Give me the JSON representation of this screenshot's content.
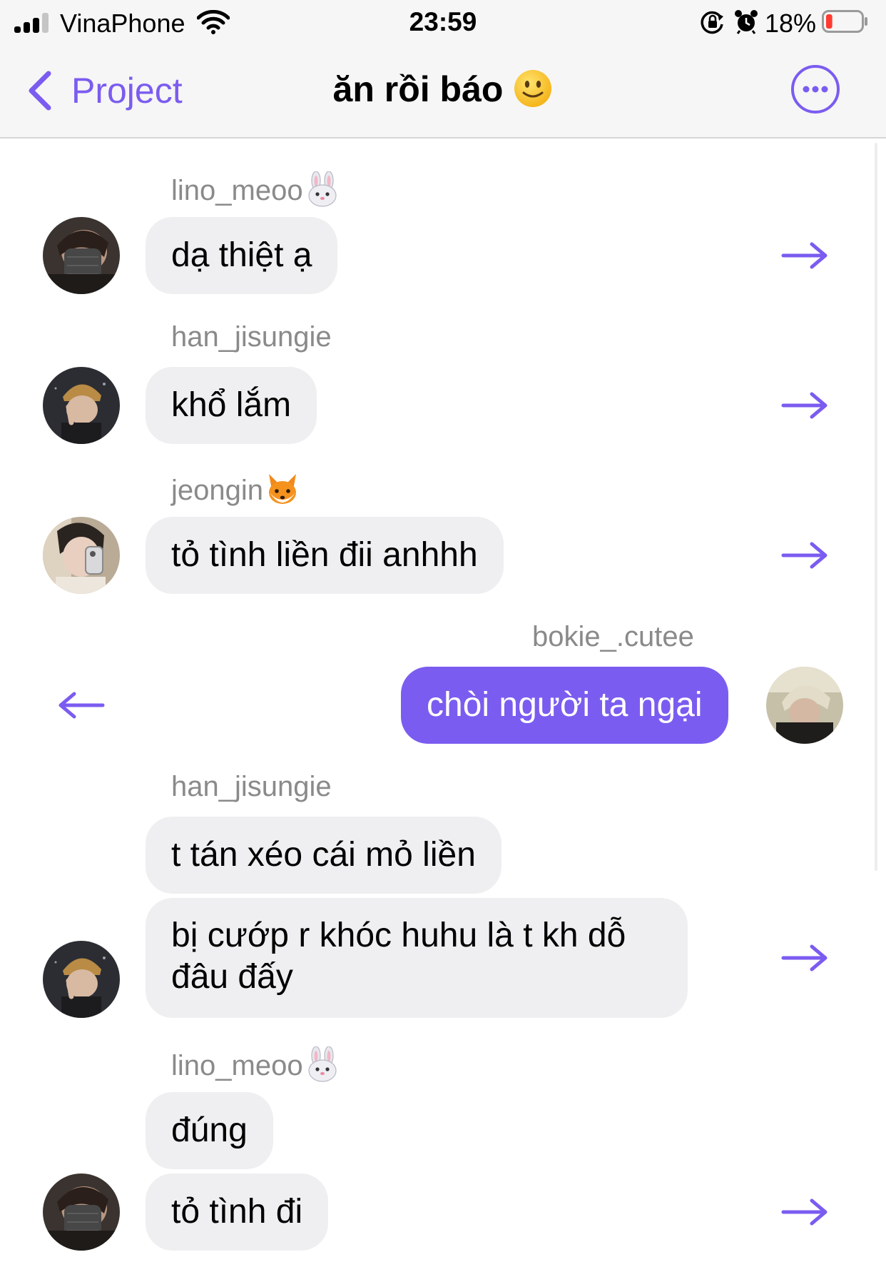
{
  "status_bar": {
    "carrier": "VinaPhone",
    "time": "23:59",
    "battery_percent": "18%",
    "battery_level": 0.18,
    "icons": [
      "signal-icon",
      "wifi-icon",
      "orientation-lock-icon",
      "alarm-icon",
      "battery-icon"
    ]
  },
  "nav": {
    "back_label": "Project",
    "title": "ăn rồi báo",
    "title_emoji": "slightly-smiling-face-icon",
    "more_icon": "more-options-icon"
  },
  "colors": {
    "accent": "#7b5cf0",
    "incoming_bubble": "#efeff1",
    "sender_name": "#8a8a8a",
    "status_bar_bg": "#f6f6f6"
  },
  "messages": [
    {
      "sender": "lino_meoo",
      "sender_emoji": "rabbit-face-icon",
      "text": "dạ thiệt ạ",
      "outgoing": false
    },
    {
      "sender": "han_jisungie",
      "text": "khổ lắm",
      "outgoing": false
    },
    {
      "sender": "jeongin",
      "sender_emoji": "fox-face-icon",
      "text": "tỏ tình liền đii anhhh",
      "outgoing": false
    },
    {
      "sender": "bokie_.cutee",
      "text": "chòi người ta ngại",
      "outgoing": true
    },
    {
      "sender": "han_jisungie",
      "text": "t tán xéo cái mỏ liền",
      "outgoing": false
    },
    {
      "text_line1": "bị cướp r khóc huhu là t kh dỗ",
      "text_line2": "đâu đấy",
      "outgoing": false
    },
    {
      "sender": "lino_meoo",
      "sender_emoji": "rabbit-face-icon",
      "text": "đúng",
      "outgoing": false
    },
    {
      "text": "tỏ tình đi",
      "outgoing": false
    }
  ]
}
